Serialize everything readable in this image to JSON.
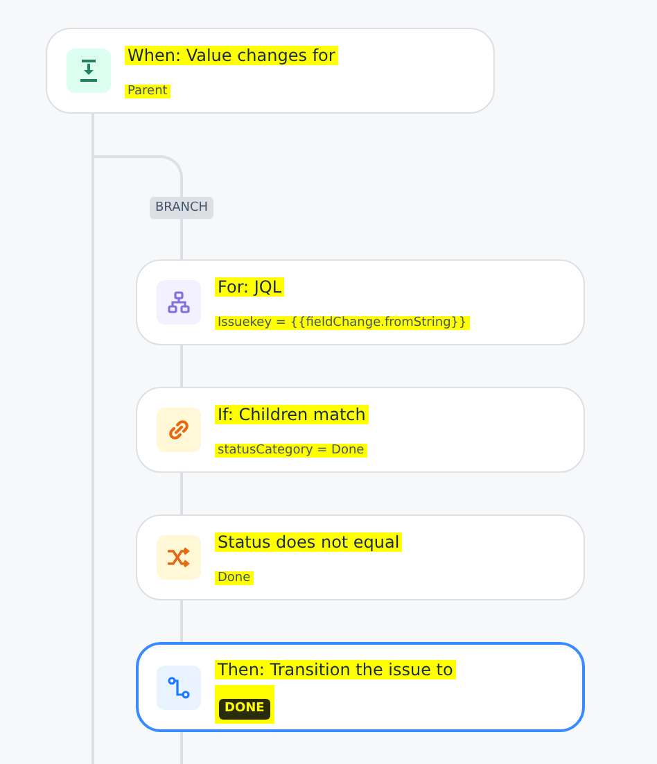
{
  "trigger": {
    "kind": "trigger",
    "title": "When: Value changes for",
    "subtitle": "Parent",
    "highlighted": true
  },
  "branch": {
    "label": "BRANCH"
  },
  "steps": [
    {
      "kind": "branch",
      "title": "For: JQL",
      "subtitle": "Issuekey = {{fieldChange.fromString}}",
      "highlighted": true,
      "selected": false
    },
    {
      "kind": "condition",
      "title": "If: Children match",
      "subtitle": "statusCategory = Done",
      "highlighted": true,
      "selected": false
    },
    {
      "kind": "compare",
      "title": "Status does not equal",
      "subtitle": "Done",
      "highlighted": true,
      "selected": false
    },
    {
      "kind": "action",
      "title": "Then: Transition the issue to",
      "status": "DONE",
      "highlighted": true,
      "selected": true
    }
  ]
}
